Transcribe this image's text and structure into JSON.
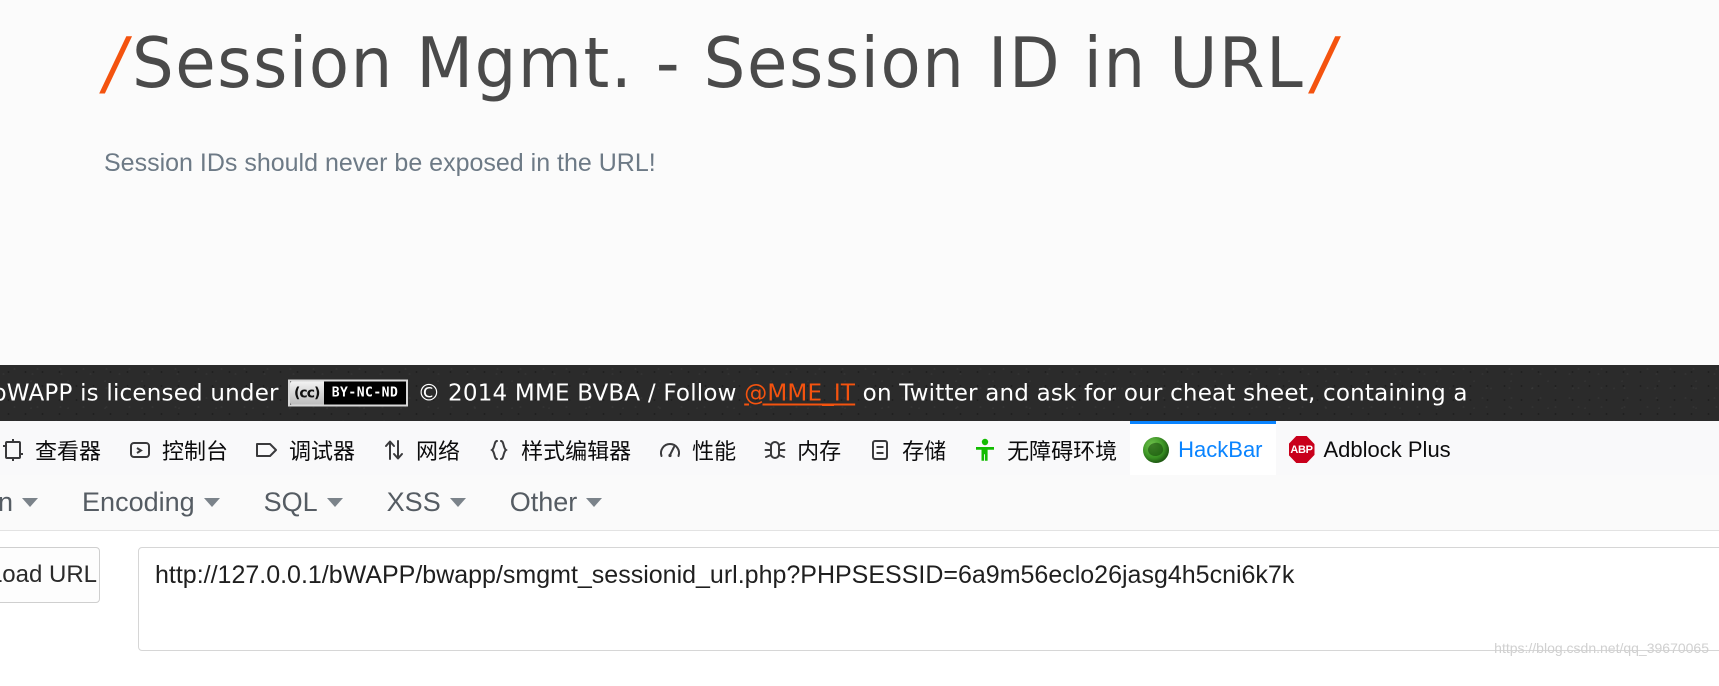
{
  "page": {
    "title_slash_left": "/",
    "title": "Session Mgmt. - Session ID in URL",
    "title_slash_right": "/",
    "subtitle": "Session IDs should never be exposed in the URL!",
    "accent_color": "#f4530f",
    "text_color": "#4a4a4a"
  },
  "footer": {
    "text_before_badge": "bWAPP is licensed under",
    "cc_mark": "(cc)",
    "cc_terms": "BY-NC-ND",
    "text_after_badge": "© 2014 MME BVBA / Follow",
    "twitter_handle": "@MME_IT",
    "text_tail": "on Twitter and ask for our cheat sheet, containing a",
    "background_color": "#2b2b2b",
    "link_color": "#f4530f"
  },
  "devtools": {
    "active_tab": "HackBar",
    "active_color": "#0a84ff",
    "tabs": [
      {
        "label": "查看器",
        "icon": "inspector-icon",
        "active": false
      },
      {
        "label": "控制台",
        "icon": "console-icon",
        "active": false
      },
      {
        "label": "调试器",
        "icon": "debugger-icon",
        "active": false
      },
      {
        "label": "网络",
        "icon": "network-icon",
        "active": false
      },
      {
        "label": "样式编辑器",
        "icon": "style-editor-icon",
        "active": false
      },
      {
        "label": "性能",
        "icon": "performance-icon",
        "active": false
      },
      {
        "label": "内存",
        "icon": "memory-icon",
        "active": false
      },
      {
        "label": "存储",
        "icon": "storage-icon",
        "active": false
      },
      {
        "label": "无障碍环境",
        "icon": "accessibility-icon",
        "active": false
      },
      {
        "label": "HackBar",
        "icon": "hackbar-icon",
        "active": true
      },
      {
        "label": "Adblock Plus",
        "icon": "adblock-plus-icon",
        "active": false
      }
    ]
  },
  "hackbar": {
    "menu": [
      {
        "label": "ryption",
        "full_label": "Encryption"
      },
      {
        "label": "Encoding"
      },
      {
        "label": "SQL"
      },
      {
        "label": "XSS"
      },
      {
        "label": "Other"
      }
    ],
    "load_url_label": "Load URL",
    "url_value": "http://127.0.0.1/bWAPP/bwapp/smgmt_sessionid_url.php?PHPSESSID=6a9m56eclo26jasg4h5cni6k7k"
  },
  "watermark": {
    "text": "https://blog.csdn.net/qq_39670065"
  }
}
